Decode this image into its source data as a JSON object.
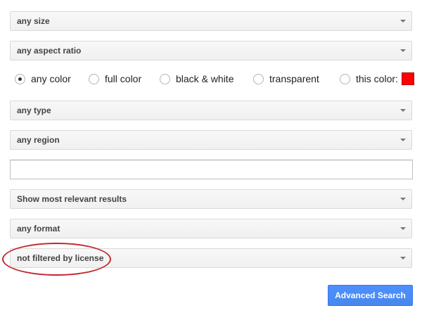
{
  "filters": {
    "size": "any size",
    "aspect_ratio": "any aspect ratio",
    "type": "any type",
    "region": "any region",
    "sort": "Show most relevant results",
    "format": "any format",
    "license": "not filtered by license"
  },
  "color_options": {
    "selected": "any color",
    "any_color": "any color",
    "full_color": "full color",
    "black_white": "black & white",
    "transparent": "transparent",
    "this_color": "this color:",
    "this_color_swatch": "#ff0000"
  },
  "site_input": {
    "value": "",
    "placeholder": ""
  },
  "annotation": {
    "color": "#c1272d"
  },
  "advanced_search_button": "Advanced Search"
}
